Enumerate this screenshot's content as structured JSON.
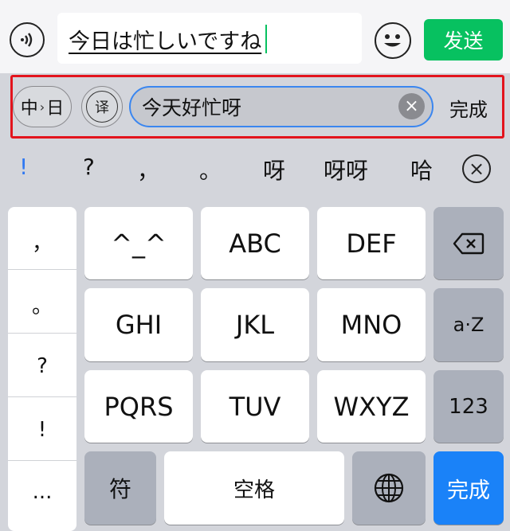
{
  "input_bar": {
    "voice_icon": "voice-icon",
    "message_text": "今日は忙しいですね",
    "emoji_icon": "emoji-icon",
    "send_label": "发送"
  },
  "translation_bar": {
    "language_pair": {
      "from": "中",
      "to": "日"
    },
    "translate_voice_label": "译",
    "translated_text": "今天好忙呀",
    "clear_icon": "clear-icon",
    "done_label": "完成",
    "highlight_color": "#e3141d"
  },
  "candidates": {
    "items": [
      "!",
      "?",
      "，",
      "。",
      "呀",
      "呀呀",
      "哈"
    ],
    "close_icon": "close-icon"
  },
  "keyboard": {
    "punctuation": [
      "，",
      "。",
      "?",
      "!",
      "..."
    ],
    "rows": [
      [
        "^_^",
        "ABC",
        "DEF"
      ],
      [
        "GHI",
        "JKL",
        "MNO"
      ],
      [
        "PQRS",
        "TUV",
        "WXYZ"
      ]
    ],
    "backspace_icon": "backspace-icon",
    "case_label": "a·Z",
    "numbers_label": "123",
    "symbols_label": "符",
    "space_label": "空格",
    "globe_icon": "globe-icon",
    "done_label": "完成",
    "accent_color": "#1a82f8",
    "send_color": "#07c160"
  }
}
